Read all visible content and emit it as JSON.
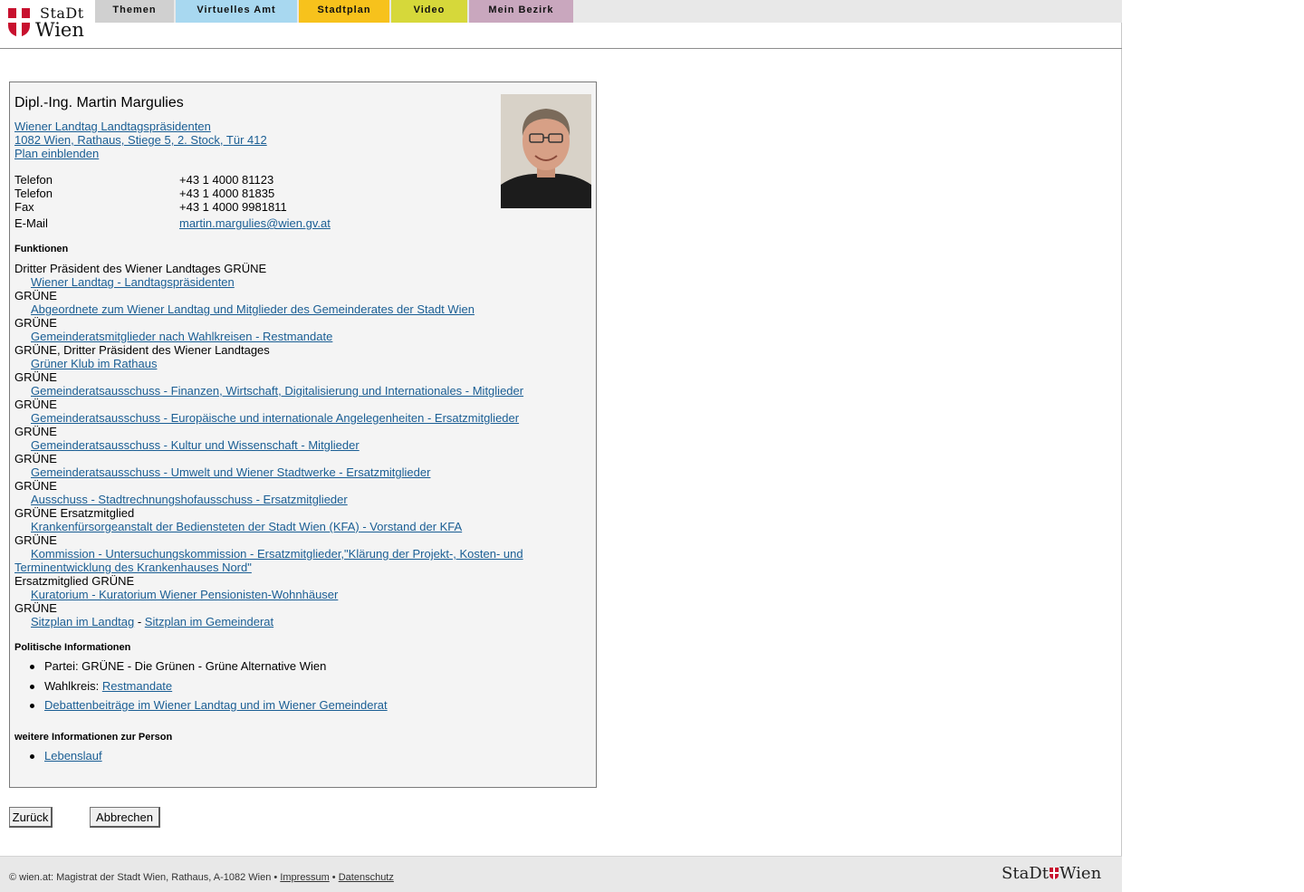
{
  "header": {
    "logo_line1": "StaDt",
    "logo_line2": "Wien",
    "nav": [
      {
        "label": "Themen",
        "color": "#d0d0d0"
      },
      {
        "label": "Virtuelles Amt",
        "color": "#a8d8f0"
      },
      {
        "label": "Stadtplan",
        "color": "#f7c21c"
      },
      {
        "label": "Video",
        "color": "#d6d83a"
      },
      {
        "label": "Mein Bezirk",
        "color": "#c9a7be"
      }
    ]
  },
  "person": {
    "name": "Dipl.-Ing. Martin Margulies",
    "org_link": "Wiener Landtag Landtagspräsidenten",
    "address_link": "1082 Wien, Rathaus, Stiege 5, 2. Stock, Tür 412",
    "plan_link": "Plan einblenden",
    "contacts": [
      {
        "label": "Telefon",
        "value": "+43 1 4000 81123"
      },
      {
        "label": "Telefon",
        "value": "+43 1 4000 81835"
      },
      {
        "label": "Fax",
        "value": "+43 1 4000 9981811"
      },
      {
        "label": "E-Mail",
        "value": "martin.margulies@wien.gv.at"
      }
    ]
  },
  "funktionen": {
    "heading": "Funktionen",
    "lines": [
      "Dritter Präsident des Wiener Landtages GRÜNE",
      "Wiener Landtag - Landtagspräsidenten",
      "GRÜNE",
      "Abgeordnete zum Wiener Landtag und Mitglieder des Gemeinderates der Stadt Wien",
      "GRÜNE",
      "Gemeinderatsmitglieder nach Wahlkreisen - Restmandate",
      "GRÜNE, Dritter Präsident des Wiener Landtages",
      "Grüner Klub im Rathaus",
      "GRÜNE",
      "Gemeinderatsausschuss - Finanzen, Wirtschaft, Digitalisierung und Internationales - Mitglieder",
      "GRÜNE",
      "Gemeinderatsausschuss - Europäische und internationale Angelegenheiten - Ersatzmitglieder",
      "GRÜNE",
      "Gemeinderatsausschuss - Kultur und Wissenschaft - Mitglieder",
      "GRÜNE",
      "Gemeinderatsausschuss - Umwelt und Wiener Stadtwerke - Ersatzmitglieder",
      "GRÜNE",
      "Ausschuss - Stadtrechnungshofausschuss - Ersatzmitglieder",
      "GRÜNE Ersatzmitglied",
      "Krankenfürsorgeanstalt der Bediensteten der Stadt Wien (KFA) - Vorstand der KFA",
      "GRÜNE",
      "Kommission - Untersuchungskommission - Ersatzmitglieder,\"Klärung der Projekt-, Kosten- und",
      "Terminentwicklung des Krankenhauses Nord\"",
      "Ersatzmitglied GRÜNE",
      "Kuratorium - Kuratorium Wiener Pensionisten-Wohnhäuser",
      "GRÜNE"
    ],
    "sitzplan_landtag": "Sitzplan im Landtag",
    "sitzplan_sep": "-",
    "sitzplan_gemeinderat": "Sitzplan im Gemeinderat"
  },
  "politisch": {
    "heading": "Politische Informationen",
    "partei": "Partei: GRÜNE - Die Grünen - Grüne Alternative Wien",
    "wahlkreis_label": "Wahlkreis:",
    "wahlkreis_link": "Restmandate",
    "debatten_link": "Debattenbeiträge im Wiener Landtag und im Wiener Gemeinderat"
  },
  "weitere": {
    "heading": "weitere Informationen zur Person",
    "lebenslauf": "Lebenslauf"
  },
  "buttons": {
    "back": "Zurück",
    "cancel": "Abbrechen"
  },
  "footer": {
    "text": "© wien.at: Magistrat der Stadt Wien, Rathaus, A-1082 Wien •",
    "impressum": "Impressum",
    "sep": "•",
    "datenschutz": "Datenschutz",
    "logo_left": "StaDt",
    "logo_right": "Wien"
  }
}
